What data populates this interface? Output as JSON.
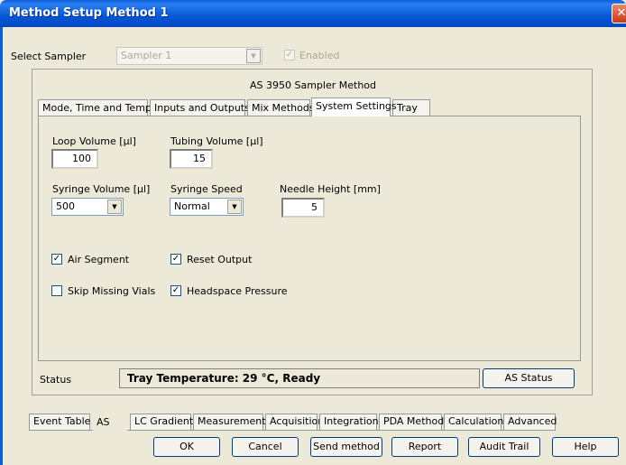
{
  "window": {
    "title": "Method Setup Method 1",
    "close_glyph": "✕"
  },
  "sampler": {
    "label": "Select Sampler",
    "value": "Sampler 1",
    "enabled_label": "Enabled",
    "enabled_checked": "✓"
  },
  "group_title": "AS 3950 Sampler Method",
  "tabs": [
    {
      "label": "Mode, Time and Temp."
    },
    {
      "label": "Inputs and Outputs"
    },
    {
      "label": "Mix Methods"
    },
    {
      "label": "System Settings"
    },
    {
      "label": "Tray"
    }
  ],
  "fields": {
    "loop_volume_label": "Loop Volume [µl]",
    "loop_volume_value": "100",
    "tubing_volume_label": "Tubing Volume [µl]",
    "tubing_volume_value": "15",
    "syringe_volume_label": "Syringe Volume [µl]",
    "syringe_volume_value": "500",
    "syringe_speed_label": "Syringe Speed",
    "syringe_speed_value": "Normal",
    "needle_height_label": "Needle Height [mm]",
    "needle_height_value": "5"
  },
  "checks": {
    "air_segment": "Air Segment",
    "reset_output": "Reset Output",
    "skip_missing_vials": "Skip Missing Vials",
    "headspace_pressure": "Headspace Pressure",
    "checkmark": "✓"
  },
  "status": {
    "label": "Status",
    "text": "Tray Temperature: 29 °C, Ready",
    "button": "AS Status"
  },
  "bottom_tabs": [
    {
      "label": "Event Table"
    },
    {
      "label": "AS"
    },
    {
      "label": "LC Gradient"
    },
    {
      "label": "Measurement"
    },
    {
      "label": "Acquisition"
    },
    {
      "label": "Integration"
    },
    {
      "label": "PDA Method"
    },
    {
      "label": "Calculation"
    },
    {
      "label": "Advanced"
    }
  ],
  "buttons": {
    "ok": "OK",
    "cancel": "Cancel",
    "send_method": "Send method",
    "report": "Report",
    "audit_trail": "Audit Trail",
    "help": "Help"
  },
  "icons": {
    "dropdown": "▼"
  }
}
